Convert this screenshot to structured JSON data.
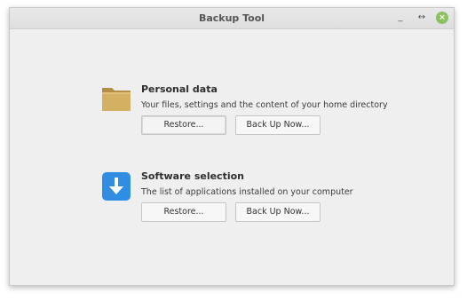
{
  "window": {
    "title": "Backup Tool",
    "controls": {
      "minimize": "_",
      "maximize": "↔",
      "close": "×"
    }
  },
  "sections": [
    {
      "icon": "folder-icon",
      "title": "Personal data",
      "description": "Your files, settings and the content of your home directory",
      "restore_label": "Restore...",
      "backup_label": "Back Up Now..."
    },
    {
      "icon": "download-arrow-icon",
      "title": "Software selection",
      "description": "The list of applications installed on your computer",
      "restore_label": "Restore...",
      "backup_label": "Back Up Now..."
    }
  ],
  "colors": {
    "folder": "#d4b062",
    "download_icon_bg": "#2f8de4",
    "close_button": "#8cc15f"
  }
}
